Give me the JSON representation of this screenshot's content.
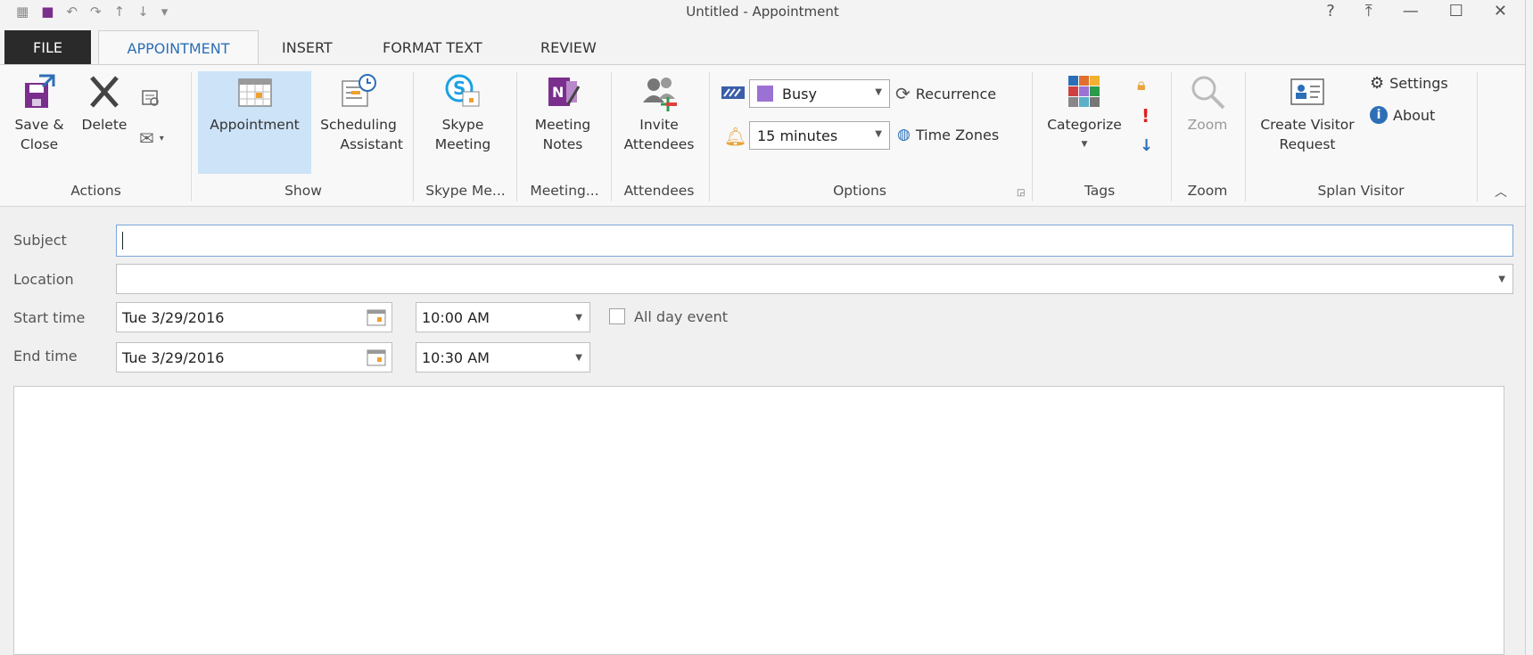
{
  "window": {
    "title": "Untitled - Appointment",
    "controls": [
      "?",
      "⤒",
      "—",
      "☐",
      "✕"
    ]
  },
  "tabs": {
    "file": "FILE",
    "appointment": "APPOINTMENT",
    "insert": "INSERT",
    "format_text": "FORMAT TEXT",
    "review": "REVIEW"
  },
  "ribbon": {
    "actions": {
      "save_close_1": "Save &",
      "save_close_2": "Close",
      "delete": "Delete",
      "label": "Actions"
    },
    "show": {
      "appointment": "Appointment",
      "scheduling_1": "Scheduling",
      "scheduling_2": "Assistant",
      "label": "Show"
    },
    "skype": {
      "line1": "Skype",
      "line2": "Meeting",
      "label": "Skype Me..."
    },
    "meeting_notes": {
      "line1": "Meeting",
      "line2": "Notes",
      "label": "Meeting..."
    },
    "attendees": {
      "line1": "Invite",
      "line2": "Attendees",
      "label": "Attendees"
    },
    "options": {
      "show_as": "Busy",
      "reminder": "15 minutes",
      "recurrence": "Recurrence",
      "time_zones": "Time Zones",
      "label": "Options",
      "busy_color": "#9b72d4"
    },
    "tags": {
      "categorize": "Categorize",
      "label": "Tags"
    },
    "zoom": {
      "button": "Zoom",
      "label": "Zoom"
    },
    "splan": {
      "settings": "Settings",
      "about": "About",
      "create_1": "Create Visitor",
      "create_2": "Request",
      "label": "Splan Visitor"
    }
  },
  "form": {
    "subject_label": "Subject",
    "subject_value": "",
    "location_label": "Location",
    "location_value": "",
    "start_label": "Start time",
    "start_date": "Tue 3/29/2016",
    "start_time": "10:00 AM",
    "all_day": "All day event",
    "end_label": "End time",
    "end_date": "Tue 3/29/2016",
    "end_time": "10:30 AM"
  },
  "colors": {
    "accent": "#2c6fb7",
    "file_tab_bg": "#2a2a2a",
    "selected_bg": "#cde3f7"
  }
}
